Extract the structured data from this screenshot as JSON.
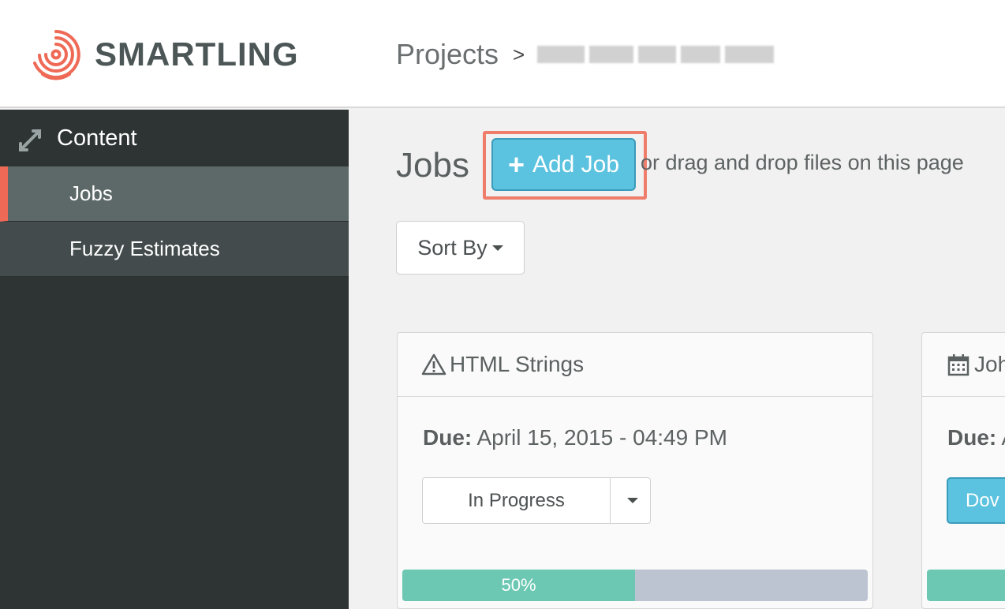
{
  "brand": {
    "name": "SMARTLING",
    "logo_color": "#ef6a56"
  },
  "breadcrumb": {
    "root": "Projects",
    "separator": ">"
  },
  "sidebar": {
    "section_title": "Content",
    "section_icon": "arrows-icon",
    "items": [
      {
        "label": "Jobs",
        "active": true
      },
      {
        "label": "Fuzzy Estimates",
        "active": false
      }
    ]
  },
  "main": {
    "title": "Jobs",
    "add_job_label": "Add Job",
    "drag_hint": "or drag and drop files on this page",
    "sort_label": "Sort By"
  },
  "cards": [
    {
      "icon": "warning-icon",
      "title": "HTML Strings",
      "due_label": "Due:",
      "due_value": "April 15, 2015 - 04:49 PM",
      "status": "In Progress",
      "progress": 50,
      "progress_label": "50%"
    },
    {
      "icon": "calendar-icon",
      "title": "Joh",
      "due_label": "Due:",
      "due_value": "A",
      "button_label": "Dov"
    }
  ],
  "colors": {
    "accent": "#5bc2df",
    "highlight": "#ef7d6c",
    "progress": "#6cc8b3",
    "sidebar": "#2e3333"
  }
}
